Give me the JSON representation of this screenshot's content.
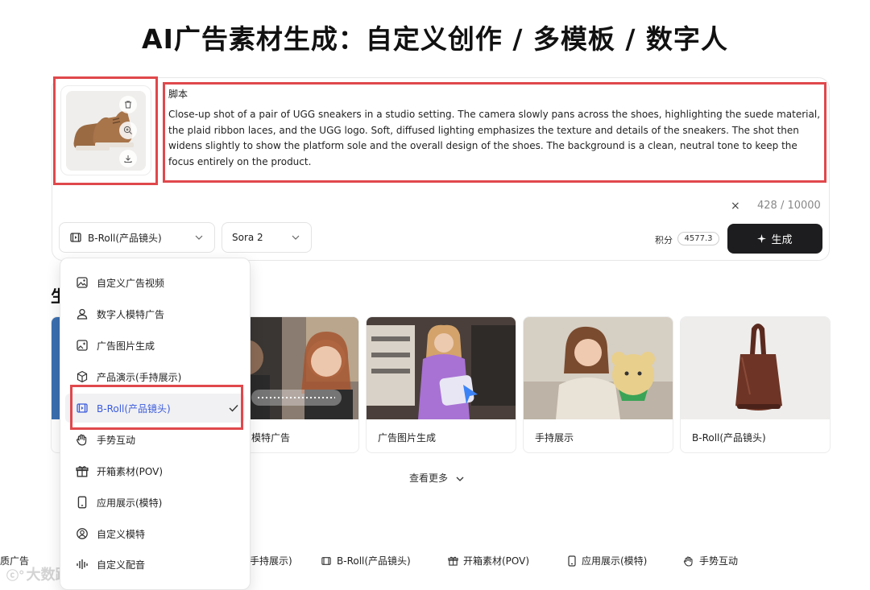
{
  "title": "AI广告素材生成：自定义创作 / 多模板 / 数字人",
  "composer": {
    "script_label": "脚本",
    "script_text": "Close-up shot of a pair of UGG sneakers in a studio setting. The camera slowly pans across the shoes, highlighting the suede material, the plaid ribbon laces, and the UGG logo. Soft, diffused lighting emphasizes the texture and details of the sneakers. The shot then widens slightly to show the platform sole and the overall design of the shoes. The background is a clean, neutral tone to keep the focus entirely on the product.",
    "clear": "×",
    "counter": "428 / 10000",
    "mode_select": "B-Roll(产品镜头)",
    "model_select": "Sora 2",
    "credits_label": "积分",
    "credits_value": "4577.3",
    "generate_label": "生成"
  },
  "section_title_peek": "生",
  "menu": {
    "items": [
      {
        "label": "自定义广告视频",
        "icon": "image-frame-icon"
      },
      {
        "label": "数字人模特广告",
        "icon": "person-icon"
      },
      {
        "label": "广告图片生成",
        "icon": "image-sparkle-icon"
      },
      {
        "label": "产品演示(手持展示)",
        "icon": "cube-icon"
      },
      {
        "label": "B-Roll(产品镜头)",
        "icon": "broll-icon",
        "selected": true
      },
      {
        "label": "手势互动",
        "icon": "hand-icon"
      },
      {
        "label": "开箱素材(POV)",
        "icon": "gift-icon"
      },
      {
        "label": "应用展示(模特)",
        "icon": "phone-icon"
      },
      {
        "label": "自定义模特",
        "icon": "user-circle-icon"
      },
      {
        "label": "自定义配音",
        "icon": "audio-wave-icon"
      }
    ]
  },
  "cards": [
    {
      "label": "模特广告"
    },
    {
      "label": "广告图片生成"
    },
    {
      "label": "手持展示"
    },
    {
      "label": "B-Roll(产品镜头)"
    }
  ],
  "see_more": "查看更多",
  "bottom_tags": [
    "质广告",
    "手持展示)",
    "B-Roll(产品镜头)",
    "开箱素材(POV)",
    "应用展示(模特)",
    "手势互动"
  ],
  "watermark": "大数跨境",
  "colors": {
    "highlight": "#e0484c",
    "accent": "#3b5bdb",
    "button": "#1d1d1f"
  }
}
